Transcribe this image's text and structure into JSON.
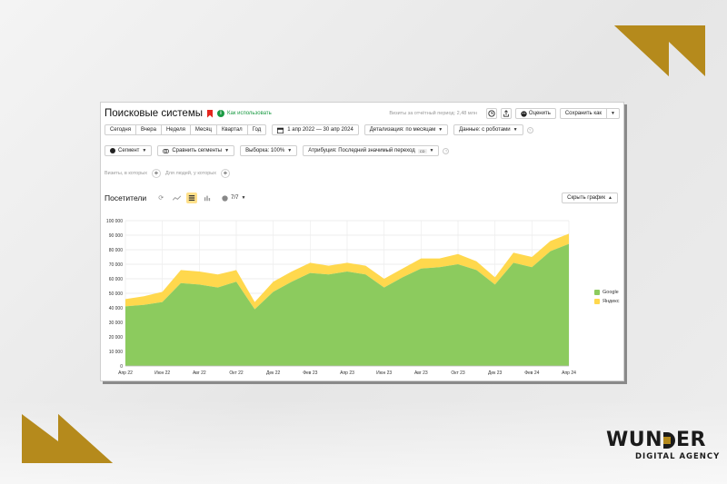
{
  "header": {
    "title": "Поисковые системы",
    "help_link": "Как использовать",
    "visits_note": "Визиты за отчётный период: 2,48 млн",
    "rate_label": "Оценить",
    "save_label": "Сохранить как"
  },
  "periods": [
    "Сегодня",
    "Вчера",
    "Неделя",
    "Месяц",
    "Квартал",
    "Год"
  ],
  "date_range": "1 апр 2022 — 30 апр 2024",
  "detail_label": "Детализация: по месяцам",
  "data_label": "Данные: с роботами",
  "segment_label": "Сегмент",
  "compare_label": "Сравнить сегменты",
  "sample_label": "Выборка: 100%",
  "attribution_label": "Атрибуция: Последний значимый переход",
  "attribution_tag": "CD",
  "filter_text_1": "Визиты, в которых",
  "filter_text_2": "Для людей, у которых",
  "visitors_label": "Посетители",
  "series_count": "7/7",
  "hide_chart_label": "Скрыть график",
  "brand": {
    "name": "WUNDER",
    "sub": "DIGITAL AGENCY"
  },
  "colors": {
    "google": "#8ccb5e",
    "yandex": "#ffd84d",
    "accent": "#b58a1c",
    "help": "#1a9a43"
  },
  "chart_data": {
    "type": "area",
    "stacked": true,
    "x": [
      "Апр 22",
      "Май 22",
      "Июн 22",
      "Июл 22",
      "Авг 22",
      "Сен 22",
      "Окт 22",
      "Ноя 22",
      "Дек 22",
      "Янв 23",
      "Фев 23",
      "Мар 23",
      "Апр 23",
      "Май 23",
      "Июн 23",
      "Июл 23",
      "Авг 23",
      "Сен 23",
      "Окт 23",
      "Ноя 23",
      "Дек 23",
      "Янв 24",
      "Фев 24",
      "Мар 24",
      "Апр 24"
    ],
    "xtick_labels": [
      "Апр 22",
      "Июн 22",
      "Авг 22",
      "Окт 22",
      "Дек 22",
      "Фев 23",
      "Апр 23",
      "Июн 23",
      "Авг 23",
      "Окт 23",
      "Дек 23",
      "Фев 24",
      "Апр 24"
    ],
    "series": [
      {
        "name": "Google",
        "color": "#8ccb5e",
        "values": [
          41000,
          42000,
          44000,
          57000,
          56000,
          54000,
          58000,
          39000,
          51000,
          58000,
          64000,
          63000,
          65000,
          63000,
          54000,
          61000,
          67000,
          68000,
          70000,
          66000,
          56000,
          71000,
          68000,
          79000,
          84000
        ]
      },
      {
        "name": "Яндекс",
        "color": "#ffd84d",
        "values": [
          5000,
          6000,
          7000,
          9000,
          9000,
          9000,
          8000,
          5000,
          7000,
          7000,
          7000,
          6000,
          6000,
          6000,
          6000,
          6000,
          7000,
          6000,
          7000,
          6000,
          5000,
          7000,
          7000,
          7000,
          7000
        ]
      }
    ],
    "yticks": [
      0,
      10000,
      20000,
      30000,
      40000,
      50000,
      60000,
      70000,
      80000,
      90000,
      100000
    ],
    "ytick_labels": [
      "0",
      "10 000",
      "20 000",
      "30 000",
      "40 000",
      "50 000",
      "60 000",
      "70 000",
      "80 000",
      "90 000",
      "100 000"
    ],
    "ylim": [
      0,
      100000
    ],
    "grid": true,
    "legend": "right"
  }
}
